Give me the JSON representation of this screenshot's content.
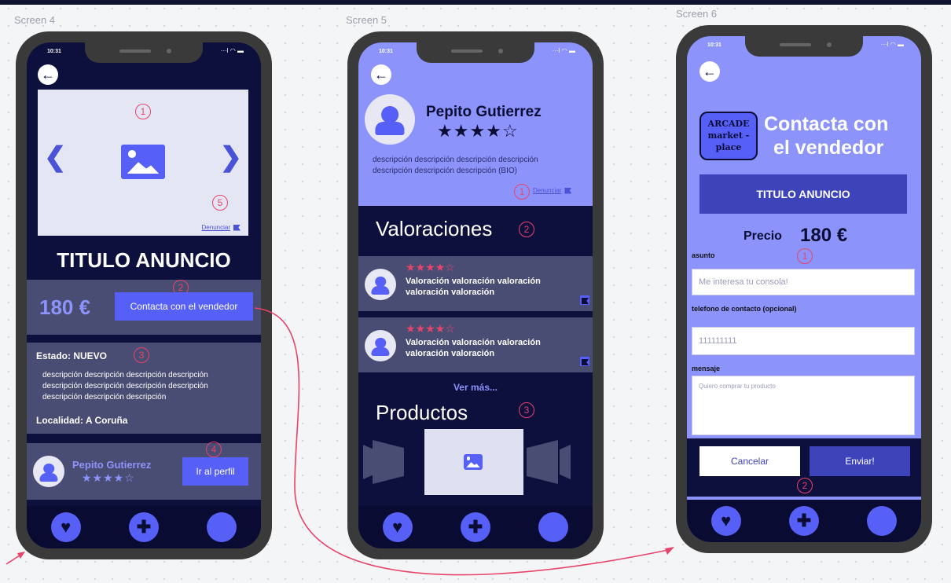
{
  "screens": [
    {
      "label": "Screen 4"
    },
    {
      "label": "Screen 5"
    },
    {
      "label": "Screen 6"
    }
  ],
  "status": {
    "time": "10:31",
    "icons": "···l ◠ ▬"
  },
  "icons": {
    "back": "←",
    "heart": "♥",
    "plus": "✚",
    "prev": "❮",
    "next": "❯"
  },
  "colors": {
    "dark_navy": "#0d0f3d",
    "periwinkle": "#8c93fb",
    "accent_blue": "#5660f6",
    "annotation_red": "#e8436a",
    "card_gray": "#4a4d73"
  },
  "s4": {
    "n1": "1",
    "n2": "2",
    "n3": "3",
    "n4": "4",
    "n5": "5",
    "report": "Denunciar",
    "title": "TITULO ANUNCIO",
    "price": "180 €",
    "contact_button": "Contacta con el vendedor",
    "estado": "Estado: NUEVO",
    "desc_lines": [
      "descripción descripción descripción descripción",
      "descripción descripción descripción descripción",
      "descripción descripción descripción"
    ],
    "localidad": "Localidad: A Coruña",
    "seller_name": "Pepito Gutierrez",
    "stars": "★★★★☆",
    "profile_button": "Ir al perfil"
  },
  "s5": {
    "n1": "1",
    "n2": "2",
    "n3": "3",
    "name": "Pepito Gutierrez",
    "stars": "★★★★☆",
    "bio_line1": "descripción descripción descripción descripción",
    "bio_line2": "descripción descripción descripción (BIO)",
    "report": "Denunciar",
    "valoraciones_title": "Valoraciones",
    "reviews": [
      {
        "stars": "★★★★☆",
        "line1": "Valoración valoración valoración",
        "line2": "valoración valoración"
      },
      {
        "stars": "★★★★☆",
        "line1": "Valoración valoración valoración",
        "line2": "valoración valoración"
      }
    ],
    "ver_mas": "Ver más...",
    "productos_title": "Productos"
  },
  "s6": {
    "n1": "1",
    "n2": "2",
    "logo_line1": "ARCADE",
    "logo_line2": "market -",
    "logo_line3": "place",
    "title_line1": "Contacta con",
    "title_line2": "el vendedor",
    "ad_title": "TITULO ANUNCIO",
    "price_label": "Precio",
    "price": "180 €",
    "asunto_label": "asunto",
    "asunto_placeholder": "Me interesa tu consola!",
    "phone_label": "telefono de contacto (opcional)",
    "phone_placeholder": "111111111",
    "mensaje_label": "mensaje",
    "mensaje_placeholder": "Quiero comprar tu producto",
    "cancel_button": "Cancelar",
    "send_button": "Enviar!"
  }
}
